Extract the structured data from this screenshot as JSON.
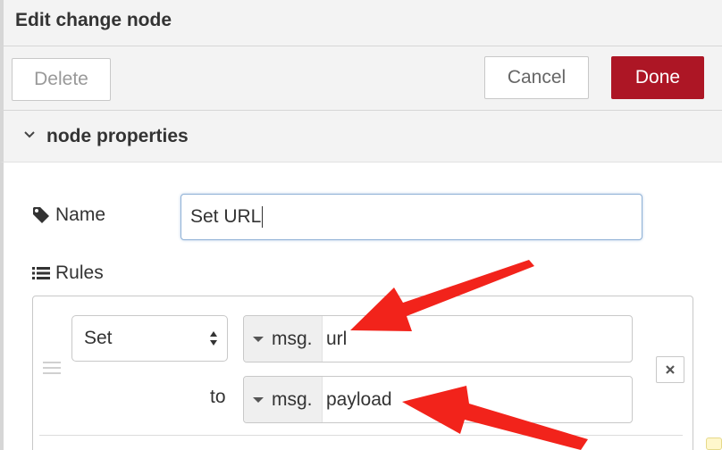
{
  "dialog": {
    "title": "Edit change node"
  },
  "toolbar": {
    "delete_label": "Delete",
    "cancel_label": "Cancel",
    "done_label": "Done"
  },
  "section": {
    "title": "node properties",
    "expanded_icon": "chevron-down-icon"
  },
  "form": {
    "name_label": "Name",
    "name_icon": "tag-icon",
    "name_value": "Set URL",
    "rules_label": "Rules",
    "rules_icon": "list-icon"
  },
  "rules": [
    {
      "action": "Set",
      "target": {
        "type_prefix": "msg.",
        "value": "url"
      },
      "to_label": "to",
      "source": {
        "type_prefix": "msg.",
        "value": "payload"
      }
    }
  ],
  "colors": {
    "done_button": "#ad1625",
    "annotation_arrow": "#f2231b",
    "focus_border": "#8fb1d6"
  }
}
